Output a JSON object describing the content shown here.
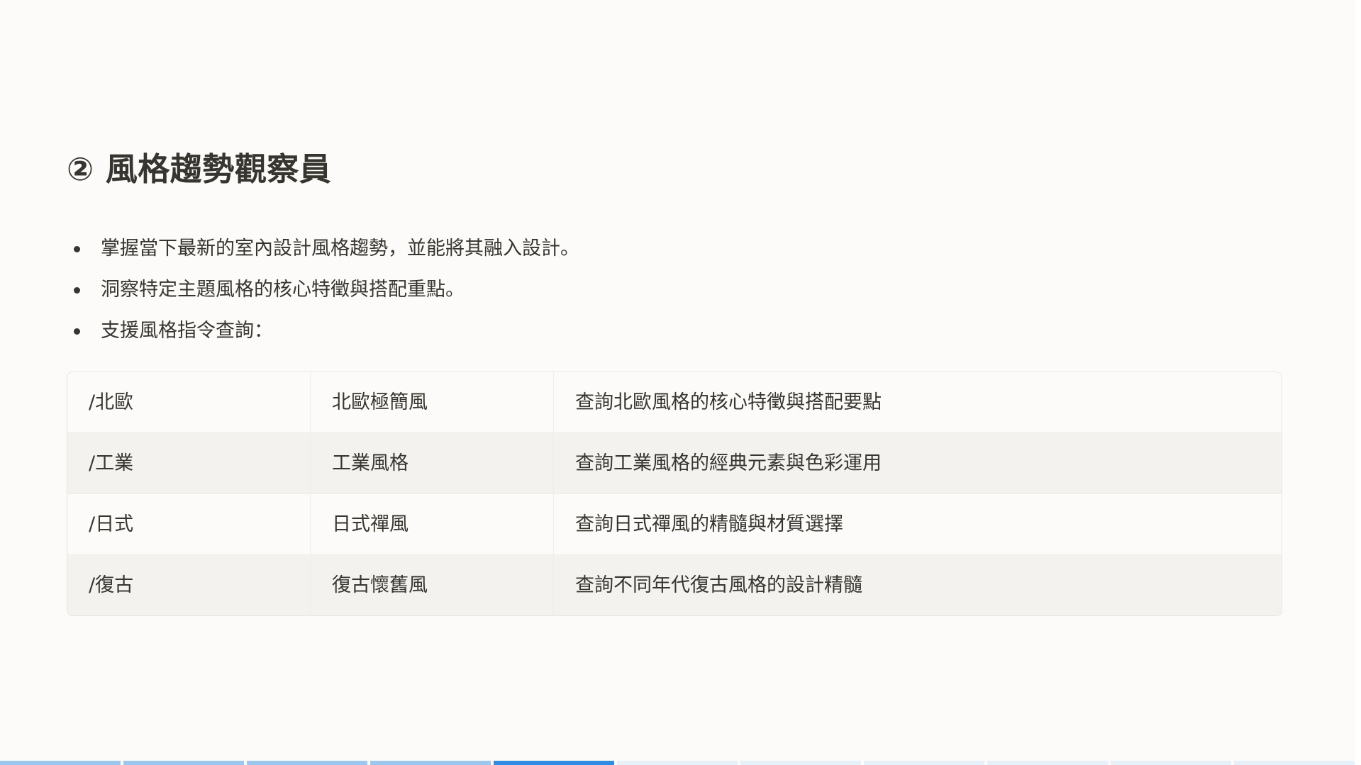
{
  "slide": {
    "title": "② 風格趨勢觀察員",
    "bullets": [
      "掌握當下最新的室內設計風格趨勢，並能將其融入設計。",
      "洞察特定主題風格的核心特徵與搭配重點。",
      "支援風格指令查詢："
    ],
    "commands": [
      {
        "command": "/北歐",
        "style": "北歐極簡風",
        "description": "查詢北歐風格的核心特徵與搭配要點"
      },
      {
        "command": "/工業",
        "style": "工業風格",
        "description": "查詢工業風格的經典元素與色彩運用"
      },
      {
        "command": "/日式",
        "style": "日式禪風",
        "description": "查詢日式禪風的精髓與材質選擇"
      },
      {
        "command": "/復古",
        "style": "復古懷舊風",
        "description": "查詢不同年代復古風格的設計精髓"
      }
    ]
  },
  "progress": {
    "total_segments": 11,
    "current_segment": 5,
    "colors": {
      "done": "#9cc8ef",
      "current": "#2f8ce0",
      "todo": "#e6f0f9"
    }
  }
}
